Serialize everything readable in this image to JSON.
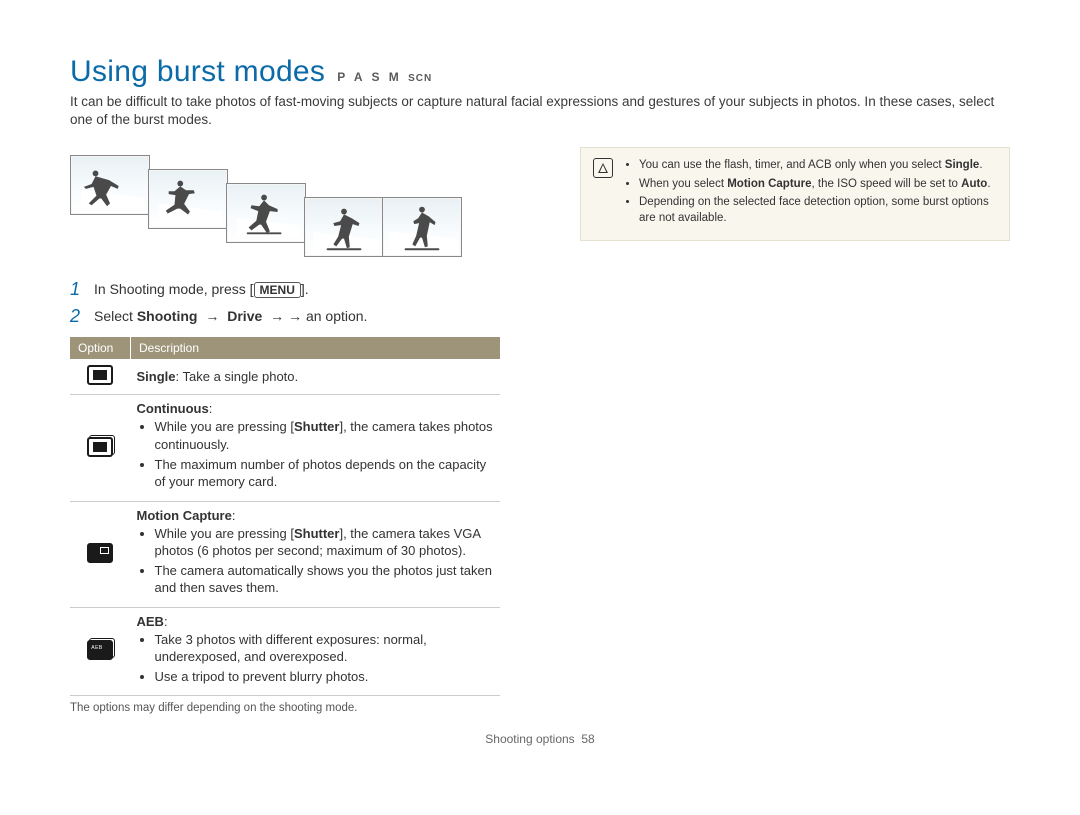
{
  "header": {
    "title": "Using burst modes",
    "modes": "P  A  S  M",
    "modes_scn": "SCN"
  },
  "intro": "It can be difficult to take photos of fast-moving subjects or capture natural facial expressions and gestures of your subjects in photos. In these cases, select one of the burst modes.",
  "steps": {
    "s1_a": "In Shooting mode, press [",
    "s1_button": "MENU",
    "s1_b": "].",
    "s2_a": "Select ",
    "s2_bold1": "Shooting",
    "s2_arrow": " → ",
    "s2_bold2": "Drive",
    "s2_b": " → an option."
  },
  "table": {
    "h1": "Option",
    "h2": "Description",
    "row_single": {
      "name": "Single",
      "rest": ": Take a single photo."
    },
    "row_continuous": {
      "name": "Continuous",
      "b1_a": "While you are pressing [",
      "b1_bold": "Shutter",
      "b1_b": "], the camera takes photos continuously.",
      "b2": "The maximum number of photos depends on the capacity of your memory card."
    },
    "row_motion": {
      "name": "Motion Capture",
      "b1_a": "While you are pressing [",
      "b1_bold": "Shutter",
      "b1_b": "], the camera takes VGA photos (6 photos per second; maximum of 30 photos).",
      "b2": "The camera automatically shows you the photos just taken and then saves them."
    },
    "row_aeb": {
      "name": "AEB",
      "b1": "Take 3 photos with different exposures: normal, underexposed, and overexposed.",
      "b2": "Use a tripod to prevent blurry photos."
    },
    "note": "The options may differ depending on the shooting mode."
  },
  "info": {
    "i1_a": "You can use the flash, timer, and ACB only when you select ",
    "i1_bold": "Single",
    "i1_b": ".",
    "i2_a": "When you select ",
    "i2_bold": "Motion Capture",
    "i2_b": ", the ISO speed will be set to ",
    "i2_bold2": "Auto",
    "i2_c": ".",
    "i3": "Depending on the selected face detection option, some burst options are not available."
  },
  "footer": {
    "section": "Shooting options",
    "page": "58"
  }
}
